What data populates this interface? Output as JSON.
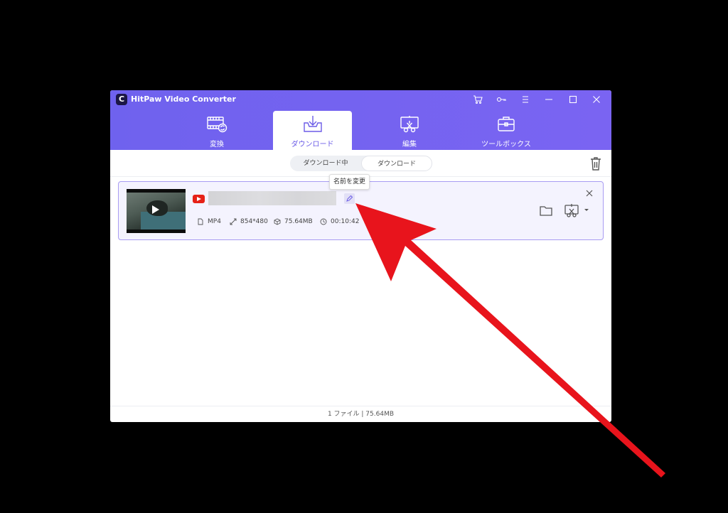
{
  "app": {
    "logo_letter": "C",
    "title": "HitPaw Video Converter"
  },
  "titlebar_icons": [
    "cart-icon",
    "key-icon",
    "menu-icon",
    "minimize-icon",
    "maximize-icon",
    "close-icon"
  ],
  "tabs": [
    {
      "label": "変換",
      "icon": "film-convert-icon"
    },
    {
      "label": "ダウンロード",
      "icon": "download-tray-icon",
      "active": true
    },
    {
      "label": "編集",
      "icon": "scissors-edit-icon"
    },
    {
      "label": "ツールボックス",
      "icon": "toolbox-icon"
    }
  ],
  "subtabs": {
    "downloading": "ダウンロード中",
    "downloaded": "ダウンロード",
    "active": "downloaded"
  },
  "item": {
    "source": "youtube-icon",
    "format": "MP4",
    "resolution": "854*480",
    "size": "75.64MB",
    "duration": "00:10:42"
  },
  "tooltip": "名前を変更",
  "footer": "1 ファイル | 75.64MB",
  "colors": {
    "header": "#7363ef",
    "accent": "#6b5ce7",
    "item_border": "#a89cf2",
    "arrow": "#e8141c"
  }
}
